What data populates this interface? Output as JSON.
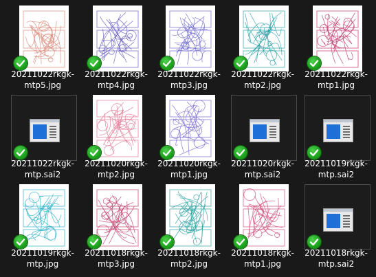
{
  "files": [
    {
      "line1": "20211022rkgk-",
      "line2": "mtp5.jpg",
      "kind": "jpg",
      "sketch_color": "#d98a7a",
      "synced": true,
      "status_icon": "sync-check-icon"
    },
    {
      "line1": "20211022rkgk-",
      "line2": "mtp4.jpg",
      "kind": "jpg",
      "sketch_color": "#6a5fc0",
      "synced": true,
      "status_icon": "sync-check-icon"
    },
    {
      "line1": "20211022rkgk-",
      "line2": "mtp3.jpg",
      "kind": "jpg",
      "sketch_color": "#6f6ad0",
      "synced": true,
      "status_icon": "sync-check-icon"
    },
    {
      "line1": "20211022rkgk-",
      "line2": "mtp2.jpg",
      "kind": "jpg",
      "sketch_color": "#2aa3a8",
      "synced": true,
      "status_icon": "sync-check-icon"
    },
    {
      "line1": "20211022rkgk-",
      "line2": "mtp1.jpg",
      "kind": "jpg",
      "sketch_color": "#c0386a",
      "synced": true,
      "status_icon": "sync-check-icon"
    },
    {
      "line1": "20211022rkgk-",
      "line2": "mtp.sai2",
      "kind": "sai2",
      "synced": true,
      "status_icon": "sync-check-icon"
    },
    {
      "line1": "20211020rkgk-",
      "line2": "mtp2.jpg",
      "kind": "jpg",
      "sketch_color": "#e07a95",
      "synced": true,
      "status_icon": "sync-check-icon"
    },
    {
      "line1": "20211020rkgk-",
      "line2": "mtp1.jpg",
      "kind": "jpg",
      "sketch_color": "#7a6ad0",
      "synced": true,
      "status_icon": "sync-check-icon"
    },
    {
      "line1": "20211020rkgk-",
      "line2": "mtp.sai2",
      "kind": "sai2",
      "synced": true,
      "status_icon": "sync-check-icon"
    },
    {
      "line1": "20211019rkgk-",
      "line2": "mtp.sai2",
      "kind": "sai2",
      "synced": true,
      "status_icon": "sync-check-icon"
    },
    {
      "line1": "20211019rkgk-",
      "line2": "mtp.jpg",
      "kind": "jpg",
      "sketch_color": "#2fb0c8",
      "synced": true,
      "status_icon": "sync-check-icon"
    },
    {
      "line1": "20211018rkgk-",
      "line2": "mtp3.jpg",
      "kind": "jpg",
      "sketch_color": "#c0406a",
      "synced": true,
      "status_icon": "sync-check-icon"
    },
    {
      "line1": "20211018rkgk-",
      "line2": "mtp2.jpg",
      "kind": "jpg",
      "sketch_color": "#2aa0a0",
      "synced": true,
      "status_icon": "sync-check-icon"
    },
    {
      "line1": "20211018rkgk-",
      "line2": "mtp1.jpg",
      "kind": "jpg",
      "sketch_color": "#d0507a",
      "synced": true,
      "status_icon": "sync-check-icon"
    },
    {
      "line1": "20211018rkgk-",
      "line2": "mtp.sai2",
      "kind": "sai2",
      "synced": true,
      "status_icon": "sync-check-icon"
    }
  ]
}
